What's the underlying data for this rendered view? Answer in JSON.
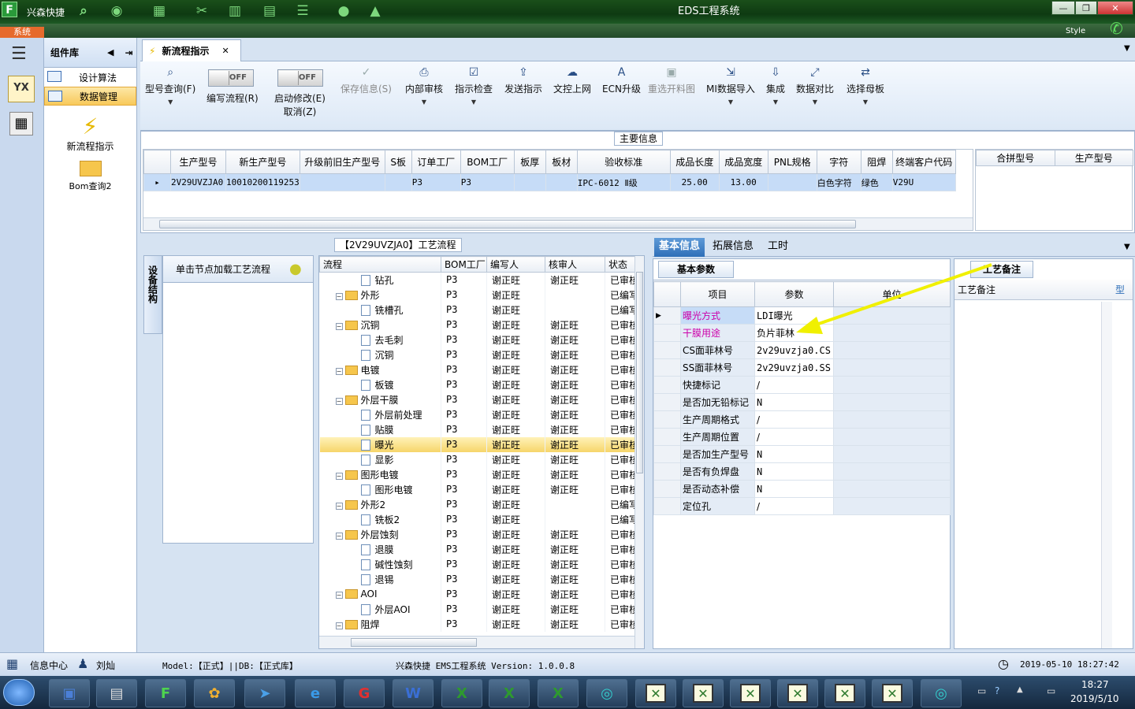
{
  "window": {
    "title": "EDS工程系统",
    "app_name": "兴森快捷",
    "style_label": "Style"
  },
  "colors": {
    "accent_green": "#1a4f1a",
    "selected_row": "#f6d56a",
    "arrow": "#f0f000",
    "highlight_text": "#cc00aa"
  },
  "system_tab": "系统",
  "component_panel": {
    "title": "组件库",
    "items": [
      {
        "label": "设计算法"
      },
      {
        "label": "数据管理"
      }
    ],
    "big_items": [
      {
        "label": "新流程指示"
      },
      {
        "label": "Bom查询2"
      }
    ]
  },
  "doc_tab": {
    "label": "新流程指示"
  },
  "toolbar": {
    "model_query": "型号查询(F)",
    "toggle_off": "OFF",
    "edit_flow": "编写流程(R)",
    "start_modify": "启动修改(E)",
    "cancel": "取消(Z)",
    "save_info": "保存信息(S)",
    "internal_review": "内部审核",
    "instruction_check": "指示检查",
    "send_instruction": "发送指示",
    "doc_upload": "文控上网",
    "ecn_upgrade": "ECN升级",
    "reselect_material": "重选开料图",
    "mi_import": "MI数据导入",
    "integrate": "集成",
    "data_compare": "数据对比",
    "select_mother": "选择母板"
  },
  "main_info": {
    "title": "主要信息",
    "headers": [
      "生产型号",
      "新生产型号",
      "升级前旧生产型号",
      "S板",
      "订单工厂",
      "BOM工厂",
      "板厚",
      "板材",
      "验收标准",
      "成品长度",
      "成品宽度",
      "PNL规格",
      "字符",
      "阻焊",
      "终端客户代码"
    ],
    "row": [
      "2V29UVZJA0",
      "10010200119253",
      "",
      "",
      "P3",
      "P3",
      "",
      "",
      "IPC-6012 Ⅱ级",
      "25.00",
      "13.00",
      "",
      "白色字符",
      "绿色",
      "V29U"
    ],
    "side_headers": [
      "合拼型号",
      "生产型号"
    ]
  },
  "side_tab": "设备结构",
  "node_panel": {
    "label": "单击节点加载工艺流程"
  },
  "flow": {
    "title": "【2V29UVZJA0】工艺流程",
    "headers": [
      "流程",
      "BOM工厂",
      "编写人",
      "核审人",
      "状态"
    ],
    "rows": [
      {
        "name": "钻孔",
        "level": 1,
        "bom": "P3",
        "writer": "谢正旺",
        "reviewer": "谢正旺",
        "status": "已审核"
      },
      {
        "name": "外形",
        "level": 0,
        "bom": "P3",
        "writer": "谢正旺",
        "reviewer": "",
        "status": "已编写"
      },
      {
        "name": "铣槽孔",
        "level": 1,
        "bom": "P3",
        "writer": "谢正旺",
        "reviewer": "",
        "status": "已编写"
      },
      {
        "name": "沉铜",
        "level": 0,
        "bom": "P3",
        "writer": "谢正旺",
        "reviewer": "谢正旺",
        "status": "已审核"
      },
      {
        "name": "去毛刺",
        "level": 1,
        "bom": "P3",
        "writer": "谢正旺",
        "reviewer": "谢正旺",
        "status": "已审核"
      },
      {
        "name": "沉铜",
        "level": 1,
        "bom": "P3",
        "writer": "谢正旺",
        "reviewer": "谢正旺",
        "status": "已审核"
      },
      {
        "name": "电镀",
        "level": 0,
        "bom": "P3",
        "writer": "谢正旺",
        "reviewer": "谢正旺",
        "status": "已审核"
      },
      {
        "name": "板镀",
        "level": 1,
        "bom": "P3",
        "writer": "谢正旺",
        "reviewer": "谢正旺",
        "status": "已审核"
      },
      {
        "name": "外层干膜",
        "level": 0,
        "bom": "P3",
        "writer": "谢正旺",
        "reviewer": "谢正旺",
        "status": "已审核"
      },
      {
        "name": "外层前处理",
        "level": 1,
        "bom": "P3",
        "writer": "谢正旺",
        "reviewer": "谢正旺",
        "status": "已审核"
      },
      {
        "name": "贴膜",
        "level": 1,
        "bom": "P3",
        "writer": "谢正旺",
        "reviewer": "谢正旺",
        "status": "已审核"
      },
      {
        "name": "曝光",
        "level": 1,
        "bom": "P3",
        "writer": "谢正旺",
        "reviewer": "谢正旺",
        "status": "已审核",
        "selected": true
      },
      {
        "name": "显影",
        "level": 1,
        "bom": "P3",
        "writer": "谢正旺",
        "reviewer": "谢正旺",
        "status": "已审核"
      },
      {
        "name": "图形电镀",
        "level": 0,
        "bom": "P3",
        "writer": "谢正旺",
        "reviewer": "谢正旺",
        "status": "已审核"
      },
      {
        "name": "图形电镀",
        "level": 1,
        "bom": "P3",
        "writer": "谢正旺",
        "reviewer": "谢正旺",
        "status": "已审核"
      },
      {
        "name": "外形2",
        "level": 0,
        "bom": "P3",
        "writer": "谢正旺",
        "reviewer": "",
        "status": "已编写"
      },
      {
        "name": "铣板2",
        "level": 1,
        "bom": "P3",
        "writer": "谢正旺",
        "reviewer": "",
        "status": "已编写"
      },
      {
        "name": "外层蚀刻",
        "level": 0,
        "bom": "P3",
        "writer": "谢正旺",
        "reviewer": "谢正旺",
        "status": "已审核"
      },
      {
        "name": "退膜",
        "level": 1,
        "bom": "P3",
        "writer": "谢正旺",
        "reviewer": "谢正旺",
        "status": "已审核"
      },
      {
        "name": "碱性蚀刻",
        "level": 1,
        "bom": "P3",
        "writer": "谢正旺",
        "reviewer": "谢正旺",
        "status": "已审核"
      },
      {
        "name": "退锡",
        "level": 1,
        "bom": "P3",
        "writer": "谢正旺",
        "reviewer": "谢正旺",
        "status": "已审核"
      },
      {
        "name": "AOI",
        "level": 0,
        "bom": "P3",
        "writer": "谢正旺",
        "reviewer": "谢正旺",
        "status": "已审核"
      },
      {
        "name": "外层AOI",
        "level": 1,
        "bom": "P3",
        "writer": "谢正旺",
        "reviewer": "谢正旺",
        "status": "已审核"
      },
      {
        "name": "阻焊",
        "level": 0,
        "bom": "P3",
        "writer": "谢正旺",
        "reviewer": "谢正旺",
        "status": "已审核"
      }
    ]
  },
  "right_tabs": [
    "基本信息",
    "拓展信息",
    "工时"
  ],
  "params": {
    "subtab": "基本参数",
    "headers": [
      "项目",
      "参数",
      "单位"
    ],
    "rows": [
      {
        "item": "曝光方式",
        "value": "LDI曝光",
        "hl": true
      },
      {
        "item": "干膜用途",
        "value": "负片菲林",
        "hl": true
      },
      {
        "item": "CS面菲林号",
        "value": "2v29uvzja0.CS"
      },
      {
        "item": "SS面菲林号",
        "value": "2v29uvzja0.SS"
      },
      {
        "item": "快捷标记",
        "value": "/"
      },
      {
        "item": "是否加无铅标记",
        "value": "N"
      },
      {
        "item": "生产周期格式",
        "value": "/"
      },
      {
        "item": "生产周期位置",
        "value": "/"
      },
      {
        "item": "是否加生产型号",
        "value": "N"
      },
      {
        "item": "是否有负焊盘",
        "value": "N"
      },
      {
        "item": "是否动态补偿",
        "value": "N"
      },
      {
        "item": "定位孔",
        "value": "/"
      }
    ]
  },
  "notes": {
    "tab": "工艺备注",
    "header": "工艺备注",
    "header2": "型"
  },
  "status": {
    "info_center": "信息中心",
    "user": "刘灿",
    "model_db": "Model:【正式】||DB:【正式库】",
    "version": "兴森快捷 EMS工程系统 Version: 1.0.0.8",
    "datetime": "2019-05-10 18:27:42"
  },
  "taskbar": {
    "time": "18:27",
    "date": "2019/5/10"
  }
}
